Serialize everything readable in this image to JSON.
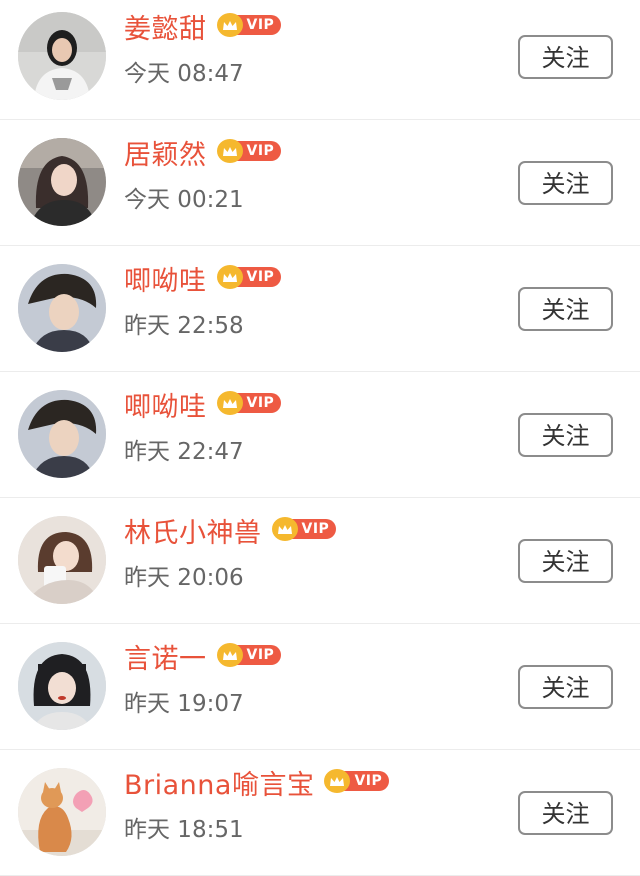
{
  "vip_label": "VIP",
  "colors": {
    "name": "#e8523a",
    "vip_badge": "#ee5a43",
    "crown": "#f5b82e",
    "time": "#666666"
  },
  "users": [
    {
      "name": "姜懿甜",
      "time": "今天 08:47",
      "follow_label": "关注",
      "avatar_icon": "user-avatar-photo"
    },
    {
      "name": "居颖然",
      "time": "今天 00:21",
      "follow_label": "关注",
      "avatar_icon": "user-avatar-photo"
    },
    {
      "name": "唧呦哇",
      "time": "昨天 22:58",
      "follow_label": "关注",
      "avatar_icon": "user-avatar-photo"
    },
    {
      "name": "唧呦哇",
      "time": "昨天 22:47",
      "follow_label": "关注",
      "avatar_icon": "user-avatar-photo"
    },
    {
      "name": "林氏小神兽",
      "time": "昨天 20:06",
      "follow_label": "关注",
      "avatar_icon": "user-avatar-photo"
    },
    {
      "name": "言诺一",
      "time": "昨天 19:07",
      "follow_label": "关注",
      "avatar_icon": "user-avatar-photo"
    },
    {
      "name": "Brianna喻言宝",
      "time": "昨天 18:51",
      "follow_label": "关注",
      "avatar_icon": "cat-avatar-photo"
    }
  ]
}
